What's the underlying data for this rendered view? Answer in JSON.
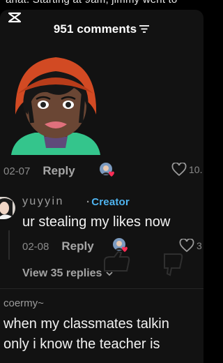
{
  "video_caption_clipped": "ahat. Starting at 9am, jimmy went to",
  "header": {
    "comments_count_label": "951 comments",
    "sort_icon": "filter-lines-icon"
  },
  "top_comment": {
    "date": "02-07",
    "reply_label": "Reply",
    "like_count": "10."
  },
  "creator_reply": {
    "username": "yuyyin",
    "creator_label": "Creator",
    "text": "ur stealing my likes now",
    "date": "02-08",
    "reply_label": "Reply",
    "like_count": "3",
    "view_replies_label": "View 35 replies"
  },
  "next_comment": {
    "username": "coermy~",
    "line1": "when my classmates talkin",
    "line2": "only i know the teacher is"
  },
  "colors": {
    "creator_accent": "#4fb4f0",
    "background": "#121212",
    "heart_pink": "#fe2c55"
  }
}
